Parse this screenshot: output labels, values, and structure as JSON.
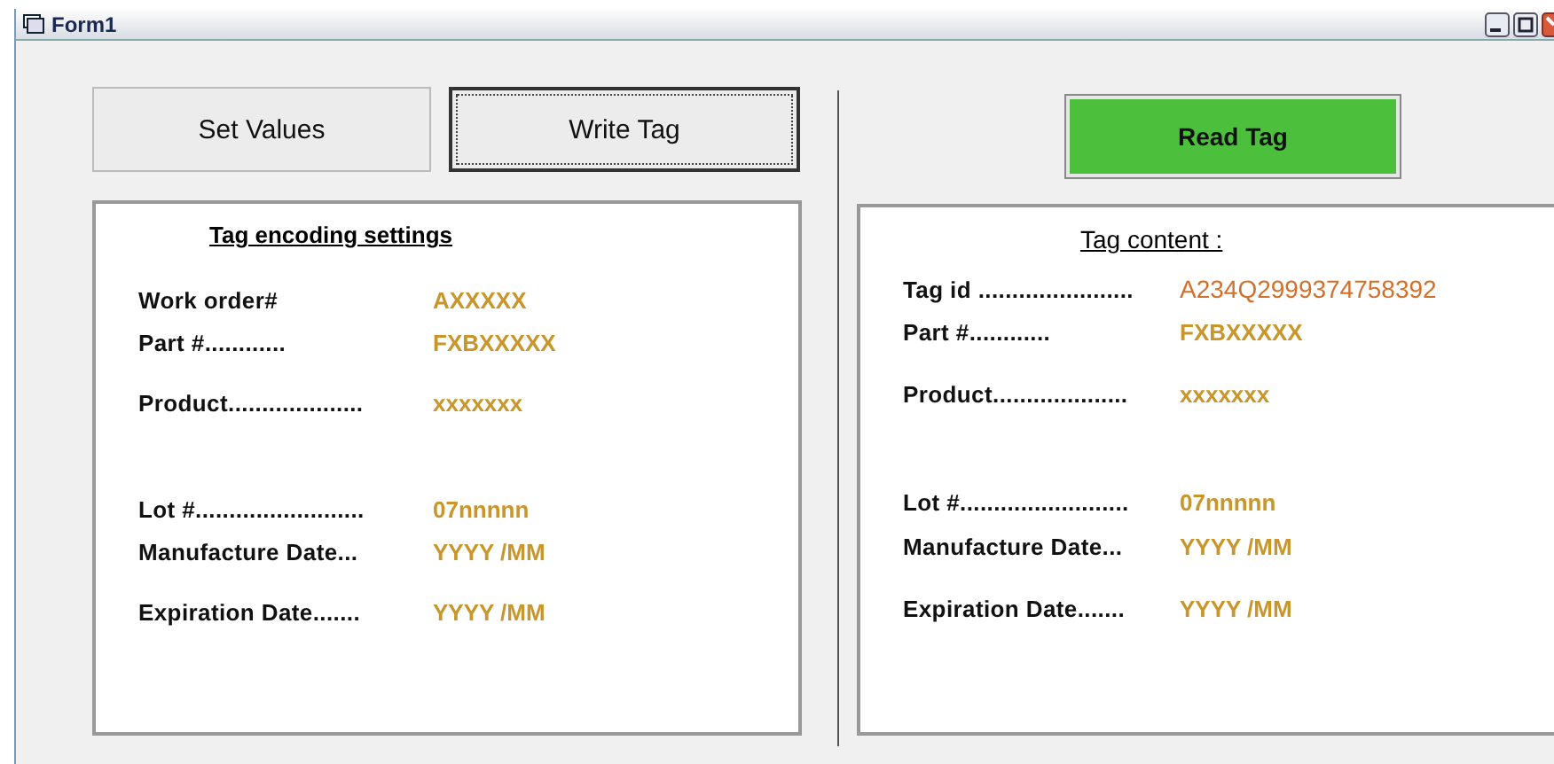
{
  "window": {
    "title": "Form1"
  },
  "buttons": [
    {
      "label": "Set Values",
      "kind": "plain",
      "focused": false
    },
    {
      "label": "Write Tag",
      "kind": "plain",
      "focused": true
    },
    {
      "label": "Read Tag",
      "kind": "primary",
      "focused": false
    }
  ],
  "panels": [
    {
      "title": "Tag encoding settings",
      "groups": [
        {
          "rows": [
            {
              "label": "Work order#",
              "value": "AXXXXX",
              "kind": "code"
            },
            {
              "label": "Part #............",
              "value": "FXBXXXXX",
              "kind": "code"
            },
            {
              "label": "Product....................",
              "value": "xxxxxxx",
              "kind": "code"
            }
          ]
        },
        {
          "rows": [
            {
              "label": "Lot #.........................",
              "value": "07nnnnn",
              "kind": "code"
            },
            {
              "label": "Manufacture Date...",
              "value": "YYYY /MM",
              "kind": "code"
            },
            {
              "label": "Expiration Date.......",
              "value": "YYYY /MM",
              "kind": "code"
            }
          ]
        }
      ]
    },
    {
      "title": "Tag content :",
      "groups": [
        {
          "rows": [
            {
              "label": "Tag id .......................",
              "value": "A234Q2999374758392",
              "kind": "id"
            },
            {
              "label": "Part #............",
              "value": "FXBXXXXX",
              "kind": "code"
            },
            {
              "label": "Product....................",
              "value": "xxxxxxx",
              "kind": "code"
            }
          ]
        },
        {
          "rows": [
            {
              "label": "Lot #.........................",
              "value": "07nnnnn",
              "kind": "code"
            },
            {
              "label": "Manufacture Date...",
              "value": "YYYY /MM",
              "kind": "code"
            },
            {
              "label": "Expiration Date.......",
              "value": "YYYY /MM",
              "kind": "code"
            }
          ]
        }
      ]
    }
  ]
}
